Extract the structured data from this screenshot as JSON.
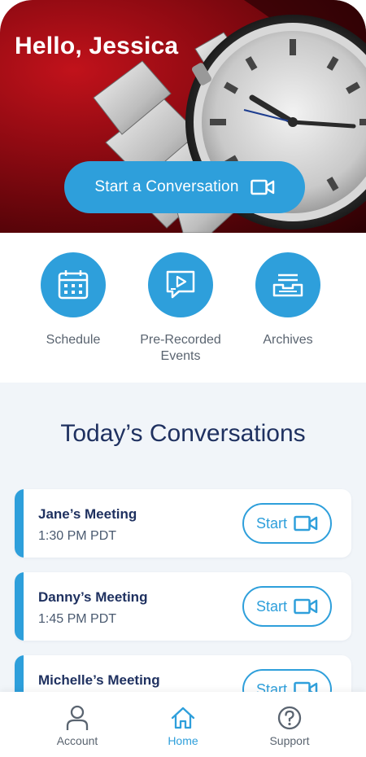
{
  "hero": {
    "greeting": "Hello, Jessica",
    "cta_label": "Start a Conversation",
    "cta_icon": "video-camera-icon"
  },
  "quick_actions": [
    {
      "label": "Schedule",
      "icon": "calendar-icon"
    },
    {
      "label": "Pre-Recorded Events",
      "icon": "video-chat-icon"
    },
    {
      "label": "Archives",
      "icon": "archive-tray-icon"
    }
  ],
  "conversations": {
    "title": "Today’s Conversations",
    "items": [
      {
        "name": "Jane’s Meeting",
        "time": "1:30 PM PDT",
        "action": "Start"
      },
      {
        "name": "Danny’s Meeting",
        "time": "1:45 PM PDT",
        "action": "Start"
      },
      {
        "name": "Michelle’s Meeting",
        "time": "",
        "action": "Start"
      }
    ]
  },
  "nav": {
    "items": [
      {
        "label": "Account",
        "icon": "person-icon"
      },
      {
        "label": "Home",
        "icon": "home-icon",
        "active": true
      },
      {
        "label": "Support",
        "icon": "question-circle-icon"
      }
    ]
  },
  "colors": {
    "accent": "#2e9fdb",
    "title": "#1f3160",
    "background": "#f1f5f9",
    "hero_red": "#8f0a12"
  }
}
